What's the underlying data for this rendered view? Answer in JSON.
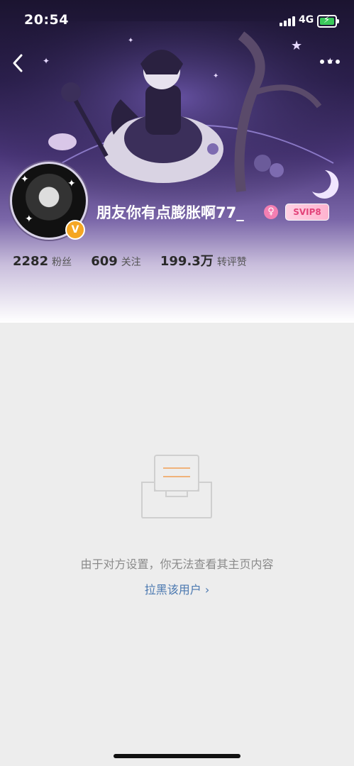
{
  "status_bar": {
    "time": "20:54",
    "network": "4G",
    "battery_color": "#3ac85a"
  },
  "nav": {
    "back_icon": "chevron-left-icon",
    "more_icon": "more-horizontal-icon"
  },
  "profile": {
    "username": "朋友你有点膨胀啊77_",
    "verified_badge": "V",
    "gender_icon": "female-icon",
    "vip_badge": "SVIP8",
    "stats": [
      {
        "value": "2282",
        "label": "粉丝"
      },
      {
        "value": "609",
        "label": "关注"
      },
      {
        "value": "199.3万",
        "label": "转评赞"
      }
    ]
  },
  "empty_state": {
    "icon": "empty-inbox-icon",
    "message": "由于对方设置，你无法查看其主页内容",
    "action_label": "拉黑该用户 ›"
  },
  "colors": {
    "accent_link": "#4a78b0",
    "verified": "#f5a623",
    "gender": "#f37fb2",
    "vip_text": "#e3447a"
  }
}
